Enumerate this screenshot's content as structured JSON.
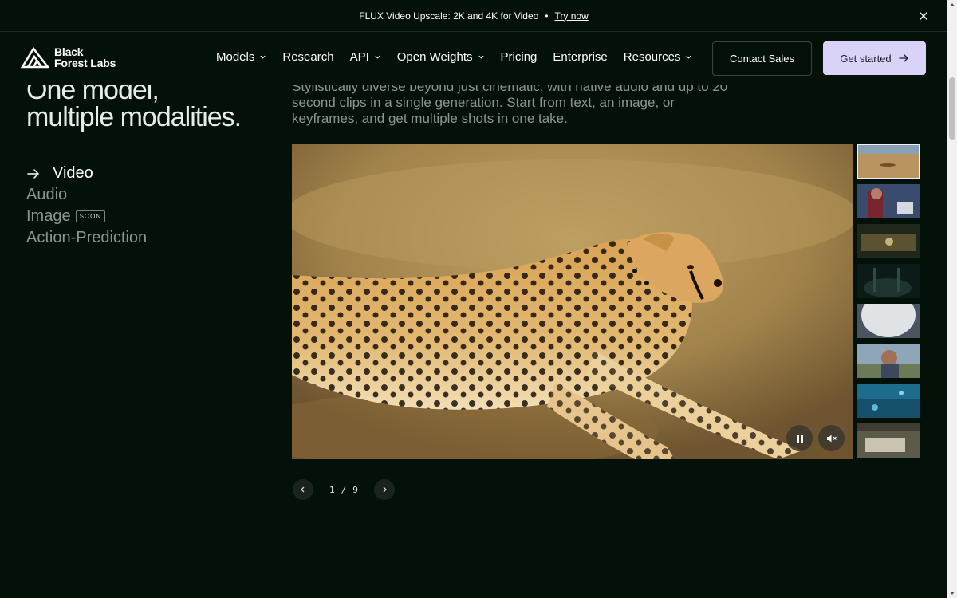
{
  "announcement": {
    "text": "FLUX Video Upscale: 2K and 4K for Video",
    "separator": "•",
    "link": "Try now"
  },
  "brand": {
    "line1": "Black",
    "line2": "Forest Labs"
  },
  "nav": {
    "items": [
      {
        "label": "Models",
        "dropdown": true
      },
      {
        "label": "Research",
        "dropdown": false
      },
      {
        "label": "API",
        "dropdown": true
      },
      {
        "label": "Open Weights",
        "dropdown": true
      },
      {
        "label": "Pricing",
        "dropdown": false
      },
      {
        "label": "Enterprise",
        "dropdown": false
      },
      {
        "label": "Resources",
        "dropdown": true
      }
    ],
    "contact_label": "Contact Sales",
    "start_label": "Get started"
  },
  "hero": {
    "headline_line1": "One model,",
    "headline_line2": "multiple modalities.",
    "description": "Stylistically diverse beyond just cinematic, with native audio and up to 20 second clips in a single generation. Start from text, an image, or keyframes, and get multiple shots in one take."
  },
  "modalities": [
    {
      "label": "Video",
      "active": true
    },
    {
      "label": "Audio",
      "active": false
    },
    {
      "label": "Image",
      "active": false,
      "badge": "SOON"
    },
    {
      "label": "Action-Prediction",
      "active": false
    }
  ],
  "player": {
    "current": "1",
    "separator": "/",
    "total": "9"
  },
  "colors": {
    "background": "#041108",
    "accent": "#d9d4f7",
    "muted_text": "#8c9690"
  }
}
